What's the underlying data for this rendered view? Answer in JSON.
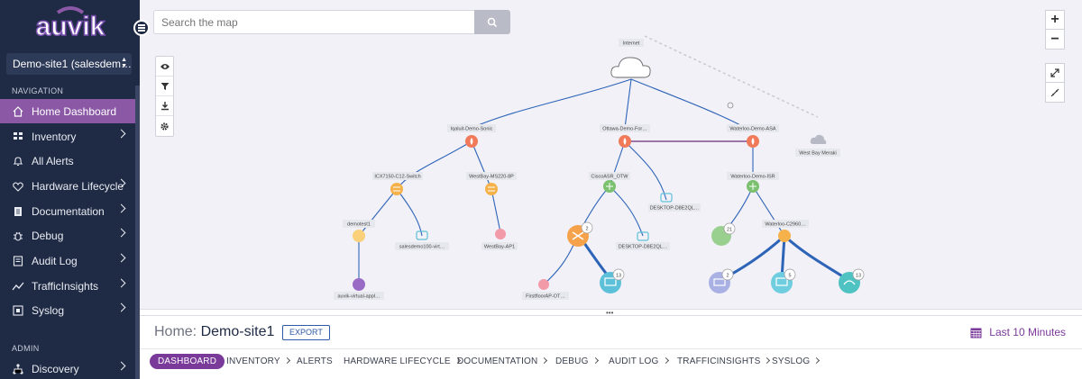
{
  "brand": {
    "logo_text": "auvik"
  },
  "sidebar": {
    "site_selector": "Demo-site1 (salesdem…",
    "nav_heading": "NAVIGATION",
    "admin_heading": "ADMIN",
    "items": [
      {
        "label": "Home Dashboard",
        "icon": "home-icon",
        "active": true
      },
      {
        "label": "Inventory",
        "icon": "inventory-icon"
      },
      {
        "label": "All Alerts",
        "icon": "bell-icon"
      },
      {
        "label": "Hardware Lifecycle",
        "icon": "heart-icon"
      },
      {
        "label": "Documentation",
        "icon": "document-icon"
      },
      {
        "label": "Debug",
        "icon": "bug-icon"
      },
      {
        "label": "Audit Log",
        "icon": "log-icon"
      },
      {
        "label": "TrafficInsights",
        "icon": "chart-icon"
      },
      {
        "label": "Syslog",
        "icon": "syslog-icon"
      }
    ],
    "admin_items": [
      {
        "label": "Discovery",
        "icon": "network-icon"
      }
    ]
  },
  "map": {
    "search_placeholder": "Search the map",
    "nodes": {
      "internet": "Internet",
      "iqaluit": "Iqaluit-Demo-Sonic",
      "ottawa": "Ottawa-Demo-For…",
      "waterloo_asa": "Waterloo-Demo-ASA",
      "west_bay_meraki": "West Bay Meraki",
      "icx": "ICX7150-C12-Switch",
      "westbay_ms220": "WestBay-MS220-8P",
      "ciscoasr": "CiscoASR_OTW",
      "desktop1": "DESKTOP-D8E2QL…",
      "waterloo_isr": "Waterloo-Demo-ISR",
      "demotest1": "demotest1",
      "salesdemo": "salesdemo100-virt…",
      "westbay_ap1": "WestBay-AP1",
      "desktop2": "DESKTOP-D8E2QL…",
      "waterloo_c2960": "Waterloo-C2960…",
      "auvik_virtual": "auvik-virtual-appl…",
      "firstfloor": "FirstfloorAP-OT…"
    },
    "badges": {
      "ottawa_switch_group": "2",
      "ottawa_desktops": "13",
      "waterloo_group": "21",
      "waterloo_printers": "2",
      "waterloo_monitors": "5",
      "waterloo_aps": "13"
    }
  },
  "panel": {
    "title_prefix": "Home:",
    "site_name": "Demo-site1",
    "export_label": "EXPORT",
    "time_range": "Last 10 Minutes",
    "tabs": [
      "DASHBOARD",
      "INVENTORY",
      "ALERTS",
      "HARDWARE LIFECYCLE",
      "DOCUMENTATION",
      "DEBUG",
      "AUDIT LOG",
      "TRAFFICINSIGHTS",
      "SYSLOG"
    ]
  },
  "colors": {
    "sidebar_bg": "#1f2a44",
    "accent": "#8b58a6",
    "firewall": "#f07a5a",
    "switch": "#f6b24a",
    "router": "#7cc16f",
    "host": "#5cc0d8",
    "ap": "#f39aa8"
  }
}
